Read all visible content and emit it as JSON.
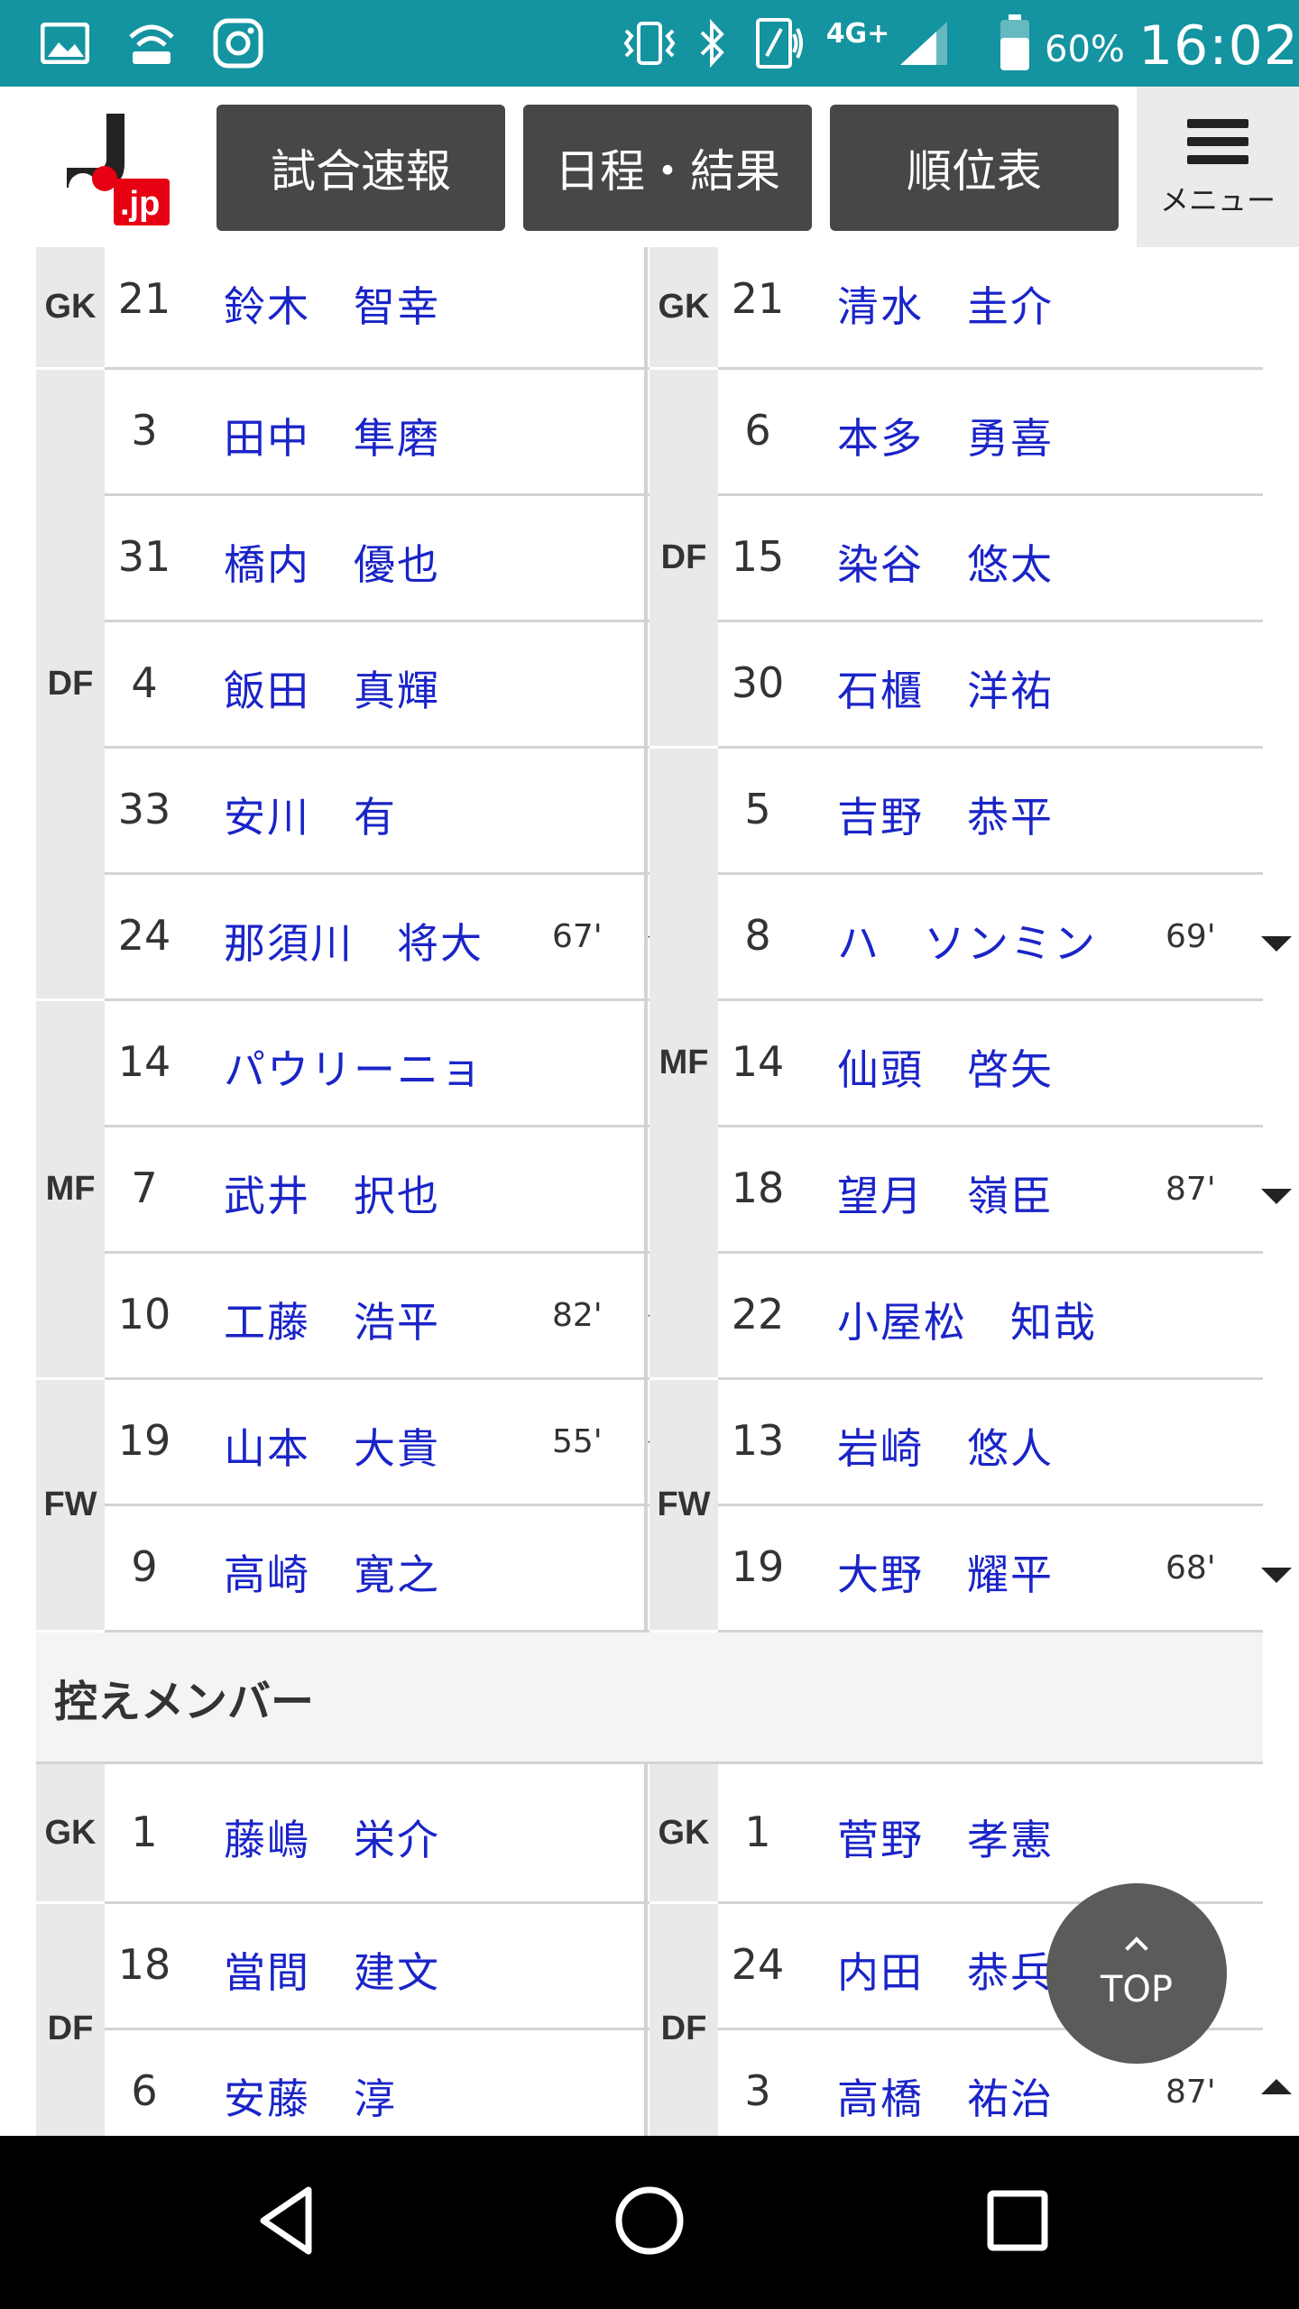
{
  "status_bar": {
    "battery_pct": "60%",
    "time": "16:02",
    "network": "4G+",
    "icons": [
      "gallery-icon",
      "wifi-hotspot-icon",
      "instagram-icon",
      "vibrate-icon",
      "bluetooth-icon",
      "nfc-icon",
      "signal-icon",
      "battery-icon"
    ]
  },
  "header": {
    "logo_text": "J.jp",
    "nav": [
      "試合速報",
      "日程・結果",
      "順位表"
    ],
    "menu_label": "メニュー"
  },
  "starting_lineup": {
    "home": [
      {
        "pos": "GK",
        "players": [
          {
            "num": "21",
            "name": "鈴木　智幸"
          }
        ]
      },
      {
        "pos": "DF",
        "players": [
          {
            "num": "3",
            "name": "田中　隼磨"
          },
          {
            "num": "31",
            "name": "橋内　優也"
          },
          {
            "num": "4",
            "name": "飯田　真輝"
          },
          {
            "num": "33",
            "name": "安川　有"
          },
          {
            "num": "24",
            "name": "那須川　将大",
            "time": "67'",
            "sub": "out"
          }
        ]
      },
      {
        "pos": "MF",
        "players": [
          {
            "num": "14",
            "name": "パウリーニョ"
          },
          {
            "num": "7",
            "name": "武井　択也"
          },
          {
            "num": "10",
            "name": "工藤　浩平",
            "time": "82'",
            "sub": "out"
          }
        ]
      },
      {
        "pos": "FW",
        "players": [
          {
            "num": "19",
            "name": "山本　大貴",
            "time": "55'",
            "sub": "out"
          },
          {
            "num": "9",
            "name": "高崎　寛之"
          }
        ]
      }
    ],
    "away": [
      {
        "pos": "GK",
        "players": [
          {
            "num": "21",
            "name": "清水　圭介"
          }
        ]
      },
      {
        "pos": "DF",
        "players": [
          {
            "num": "6",
            "name": "本多　勇喜"
          },
          {
            "num": "15",
            "name": "染谷　悠太"
          },
          {
            "num": "30",
            "name": "石櫃　洋祐"
          }
        ]
      },
      {
        "pos": "MF",
        "players": [
          {
            "num": "5",
            "name": "吉野　恭平"
          },
          {
            "num": "8",
            "name": "ハ　ソンミン",
            "time": "69'",
            "sub": "out"
          },
          {
            "num": "14",
            "name": "仙頭　啓矢"
          },
          {
            "num": "18",
            "name": "望月　嶺臣",
            "time": "87'",
            "sub": "out"
          },
          {
            "num": "22",
            "name": "小屋松　知哉"
          }
        ]
      },
      {
        "pos": "FW",
        "players": [
          {
            "num": "13",
            "name": "岩崎　悠人"
          },
          {
            "num": "19",
            "name": "大野　耀平",
            "time": "68'",
            "sub": "out"
          }
        ]
      }
    ]
  },
  "subs_title": "控えメンバー",
  "subs": {
    "home": [
      {
        "pos": "GK",
        "players": [
          {
            "num": "1",
            "name": "藤嶋　栄介"
          }
        ]
      },
      {
        "pos": "DF",
        "players": [
          {
            "num": "18",
            "name": "當間　建文"
          },
          {
            "num": "6",
            "name": "安藤　淳"
          }
        ]
      }
    ],
    "away": [
      {
        "pos": "GK",
        "players": [
          {
            "num": "1",
            "name": "菅野　孝憲"
          }
        ]
      },
      {
        "pos": "DF",
        "players": [
          {
            "num": "24",
            "name": "内田　恭兵"
          },
          {
            "num": "3",
            "name": "高橋　祐治",
            "time": "87'",
            "sub": "in"
          }
        ]
      }
    ]
  },
  "top_button": "TOP",
  "android_nav": [
    "back-icon",
    "home-icon",
    "recents-icon"
  ]
}
